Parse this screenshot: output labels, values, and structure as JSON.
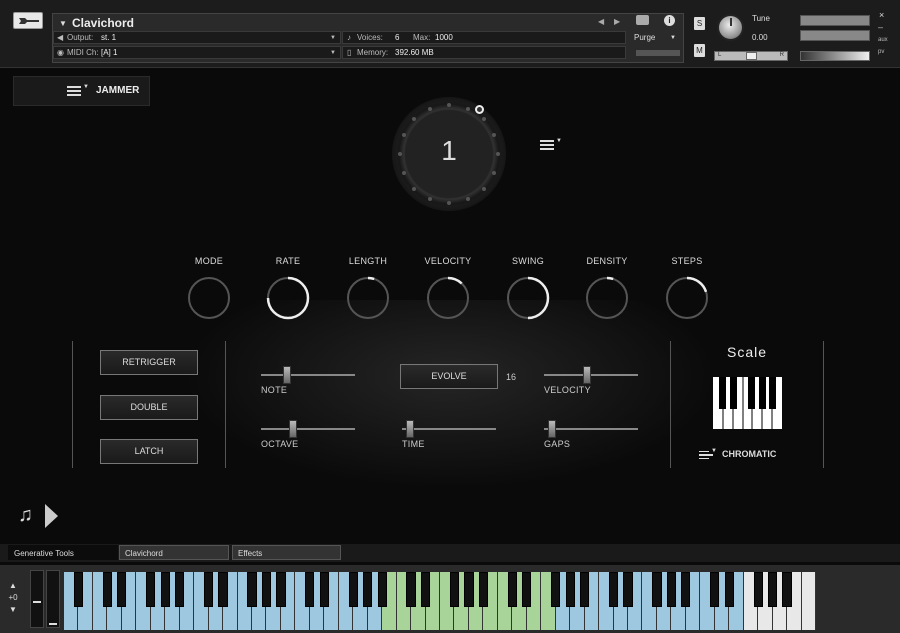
{
  "header": {
    "instrument_name": "Clavichord",
    "output_label": "Output:",
    "output_value": "st. 1",
    "midi_label": "MIDI Ch:",
    "midi_value": "[A]  1",
    "voices_label": "Voices:",
    "voices_value": "6",
    "max_label": "Max:",
    "max_value": "1000",
    "memory_label": "Memory:",
    "memory_value": "392.60 MB",
    "purge_label": "Purge",
    "solo_label": "S",
    "mute_label": "M",
    "tune_label": "Tune",
    "tune_value": "0.00",
    "close_label": "×",
    "minimize_label": "–",
    "aux_label": "aux",
    "pv_label": "pv",
    "pan_left": "L",
    "pan_right": "R"
  },
  "jammer": {
    "label": "JAMMER"
  },
  "main_dial": {
    "value": "1"
  },
  "knobs": [
    {
      "label": "MODE",
      "level": 0.0
    },
    {
      "label": "RATE",
      "level": 0.75
    },
    {
      "label": "LENGTH",
      "level": 0.05
    },
    {
      "label": "VELOCITY",
      "level": 0.12
    },
    {
      "label": "SWING",
      "level": 0.5
    },
    {
      "label": "DENSITY",
      "level": 0.05
    },
    {
      "label": "STEPS",
      "level": 0.2
    }
  ],
  "buttons": {
    "retrigger": "RETRIGGER",
    "double": "DOUBLE",
    "latch": "LATCH",
    "evolve": "EVOLVE",
    "evolve_value": "16"
  },
  "sliders": [
    {
      "label": "NOTE",
      "level": 0.25
    },
    {
      "label": "OCTAVE",
      "level": 0.33
    },
    {
      "label": "TIME",
      "level": 0.05
    },
    {
      "label": "VELOCITY",
      "level": 0.45
    },
    {
      "label": "GAPS",
      "level": 0.05
    }
  ],
  "scale": {
    "title": "Scale",
    "mode": "CHROMATIC"
  },
  "tabs": [
    {
      "label": "Generative Tools",
      "active": true
    },
    {
      "label": "Clavichord",
      "active": false
    },
    {
      "label": "Effects",
      "active": false
    }
  ],
  "keyboard": {
    "octave_offset": "+0",
    "colors": {
      "blue": "#9ec8e0",
      "green": "#a8d49a",
      "white": "#e8e8e8",
      "accent": "#ffffff"
    }
  }
}
